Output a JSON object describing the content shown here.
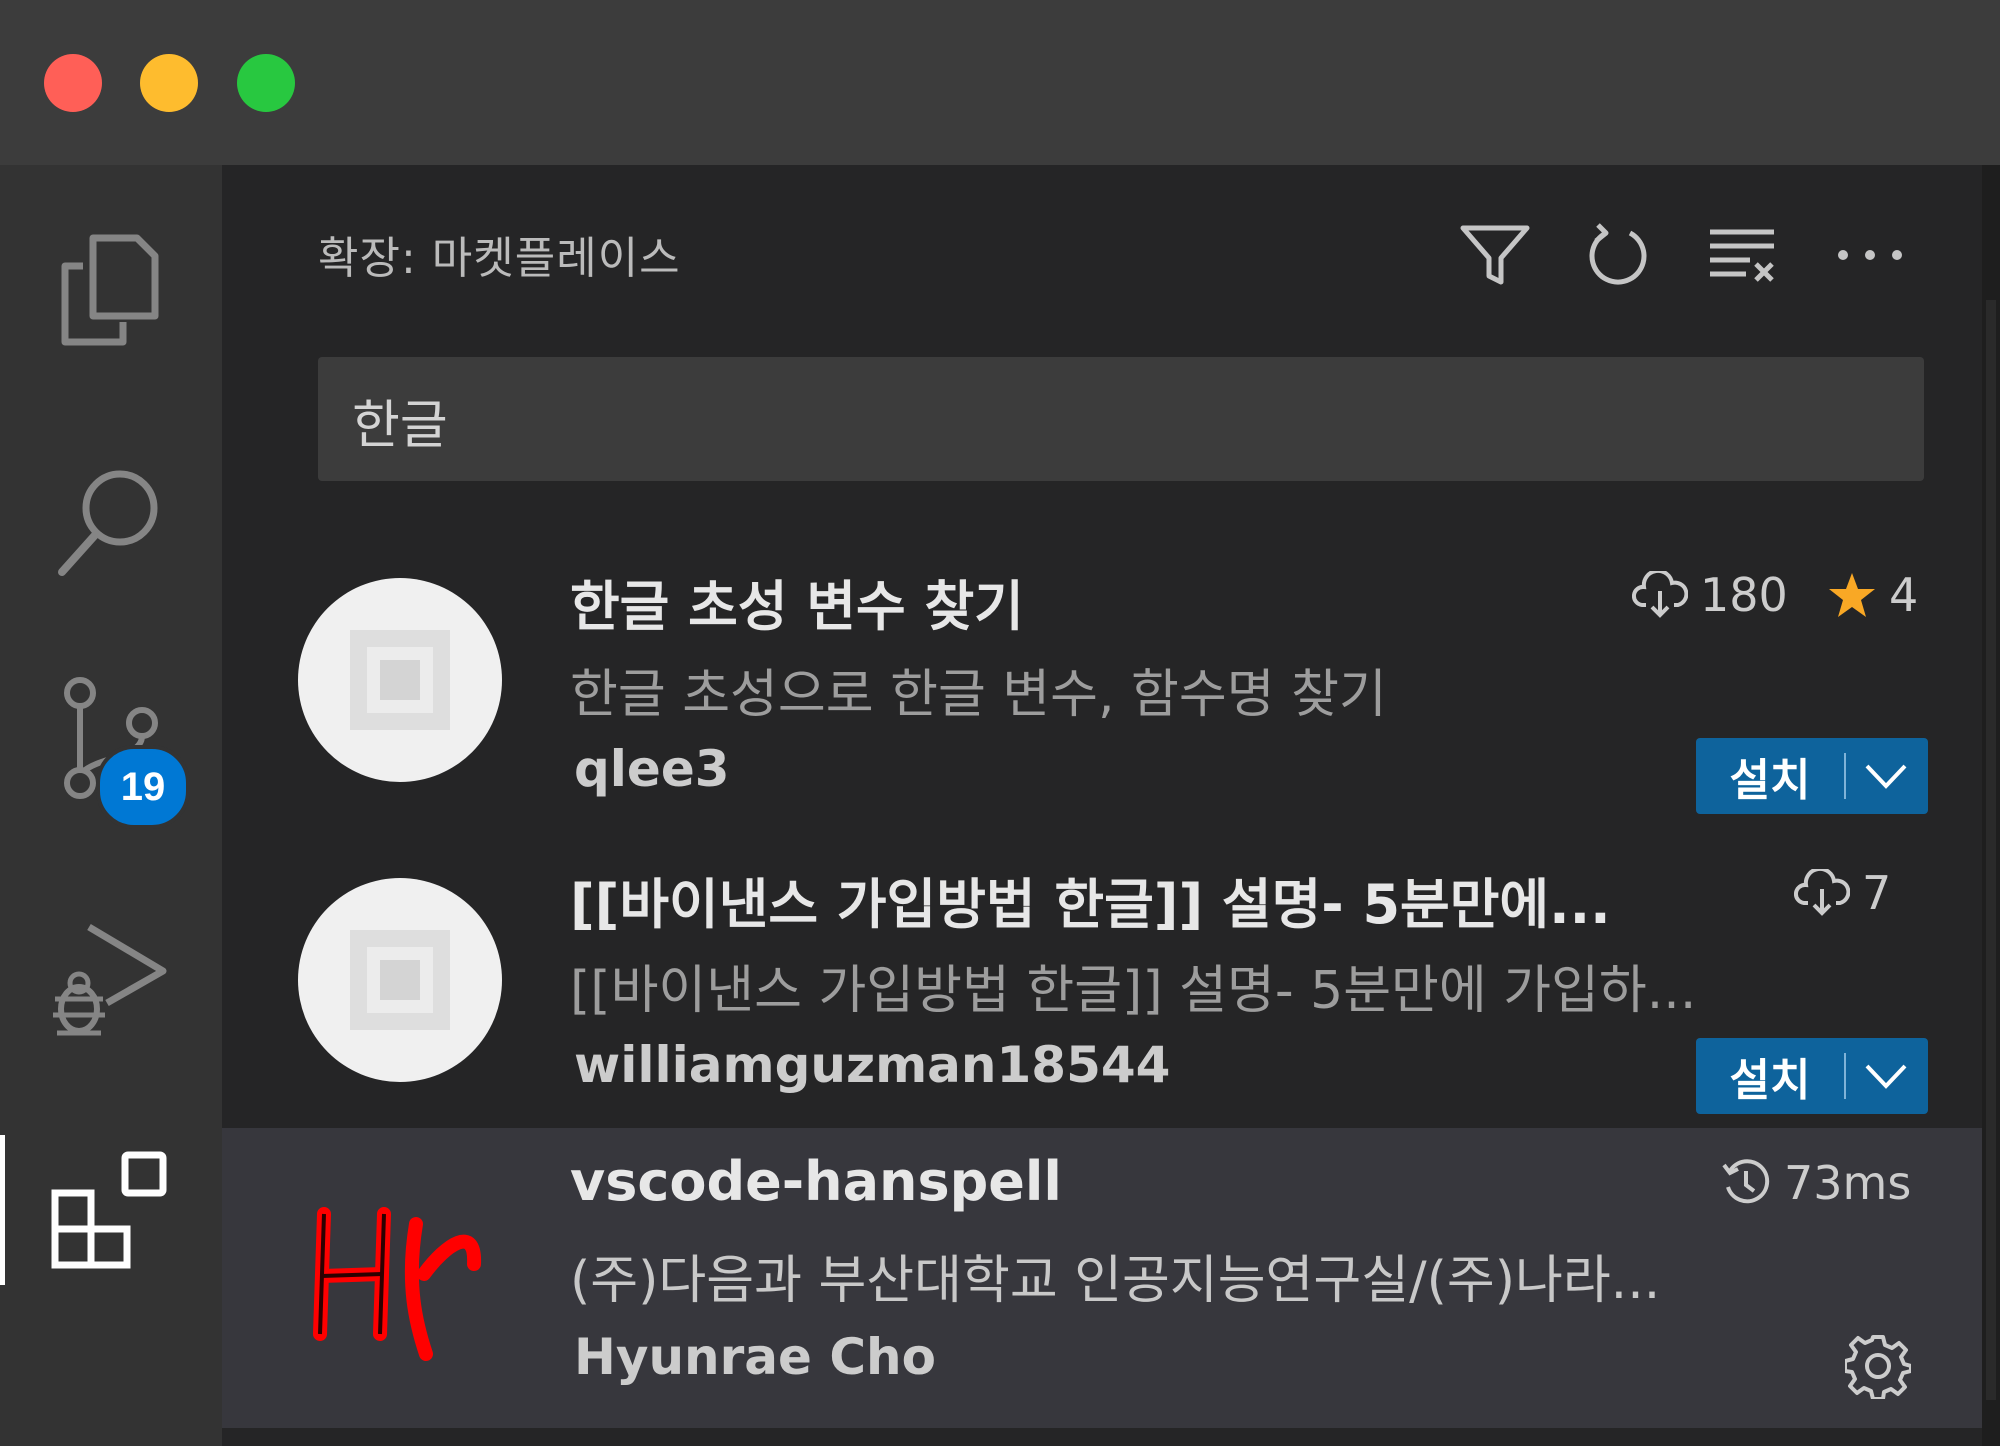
{
  "window": {
    "traffic_lights": [
      "close",
      "minimize",
      "zoom"
    ]
  },
  "activity_bar": {
    "items": [
      {
        "name": "explorer",
        "icon": "files-icon"
      },
      {
        "name": "search",
        "icon": "search-icon"
      },
      {
        "name": "source-control",
        "icon": "source-control-icon",
        "badge": "19"
      },
      {
        "name": "run-and-debug",
        "icon": "debug-icon"
      },
      {
        "name": "extensions",
        "icon": "extensions-icon",
        "active": true
      }
    ]
  },
  "sidebar": {
    "title": "확장: 마켓플레이스",
    "actions": [
      "filter-icon",
      "refresh-icon",
      "clear-icon",
      "more-icon"
    ]
  },
  "search": {
    "value": "한글"
  },
  "extensions": [
    {
      "name": "한글 초성 변수 찾기",
      "description": "한글 초성으로 한글 변수, 함수명 찾기",
      "publisher": "qlee3",
      "downloads": "180",
      "rating": "4",
      "install_label": "설치"
    },
    {
      "name": "[[바이낸스 가입방법 한글]] 설명- 5분만에...",
      "description": "[[바이낸스 가입방법 한글]] 설명- 5분만에 가입하...",
      "publisher": "williamguzman18544",
      "downloads": "7",
      "install_label": "설치"
    },
    {
      "name": "vscode-hanspell",
      "description": "(주)다음과 부산대학교 인공지능연구실/(주)나라...",
      "publisher": "Hyunrae Cho",
      "activation_time": "73ms",
      "logo_text": "H",
      "selected": true
    }
  ],
  "colors": {
    "accent": "#0e639c",
    "badge": "#0078d4",
    "star": "#f9a825",
    "hanspell_logo": "#ff0000"
  }
}
